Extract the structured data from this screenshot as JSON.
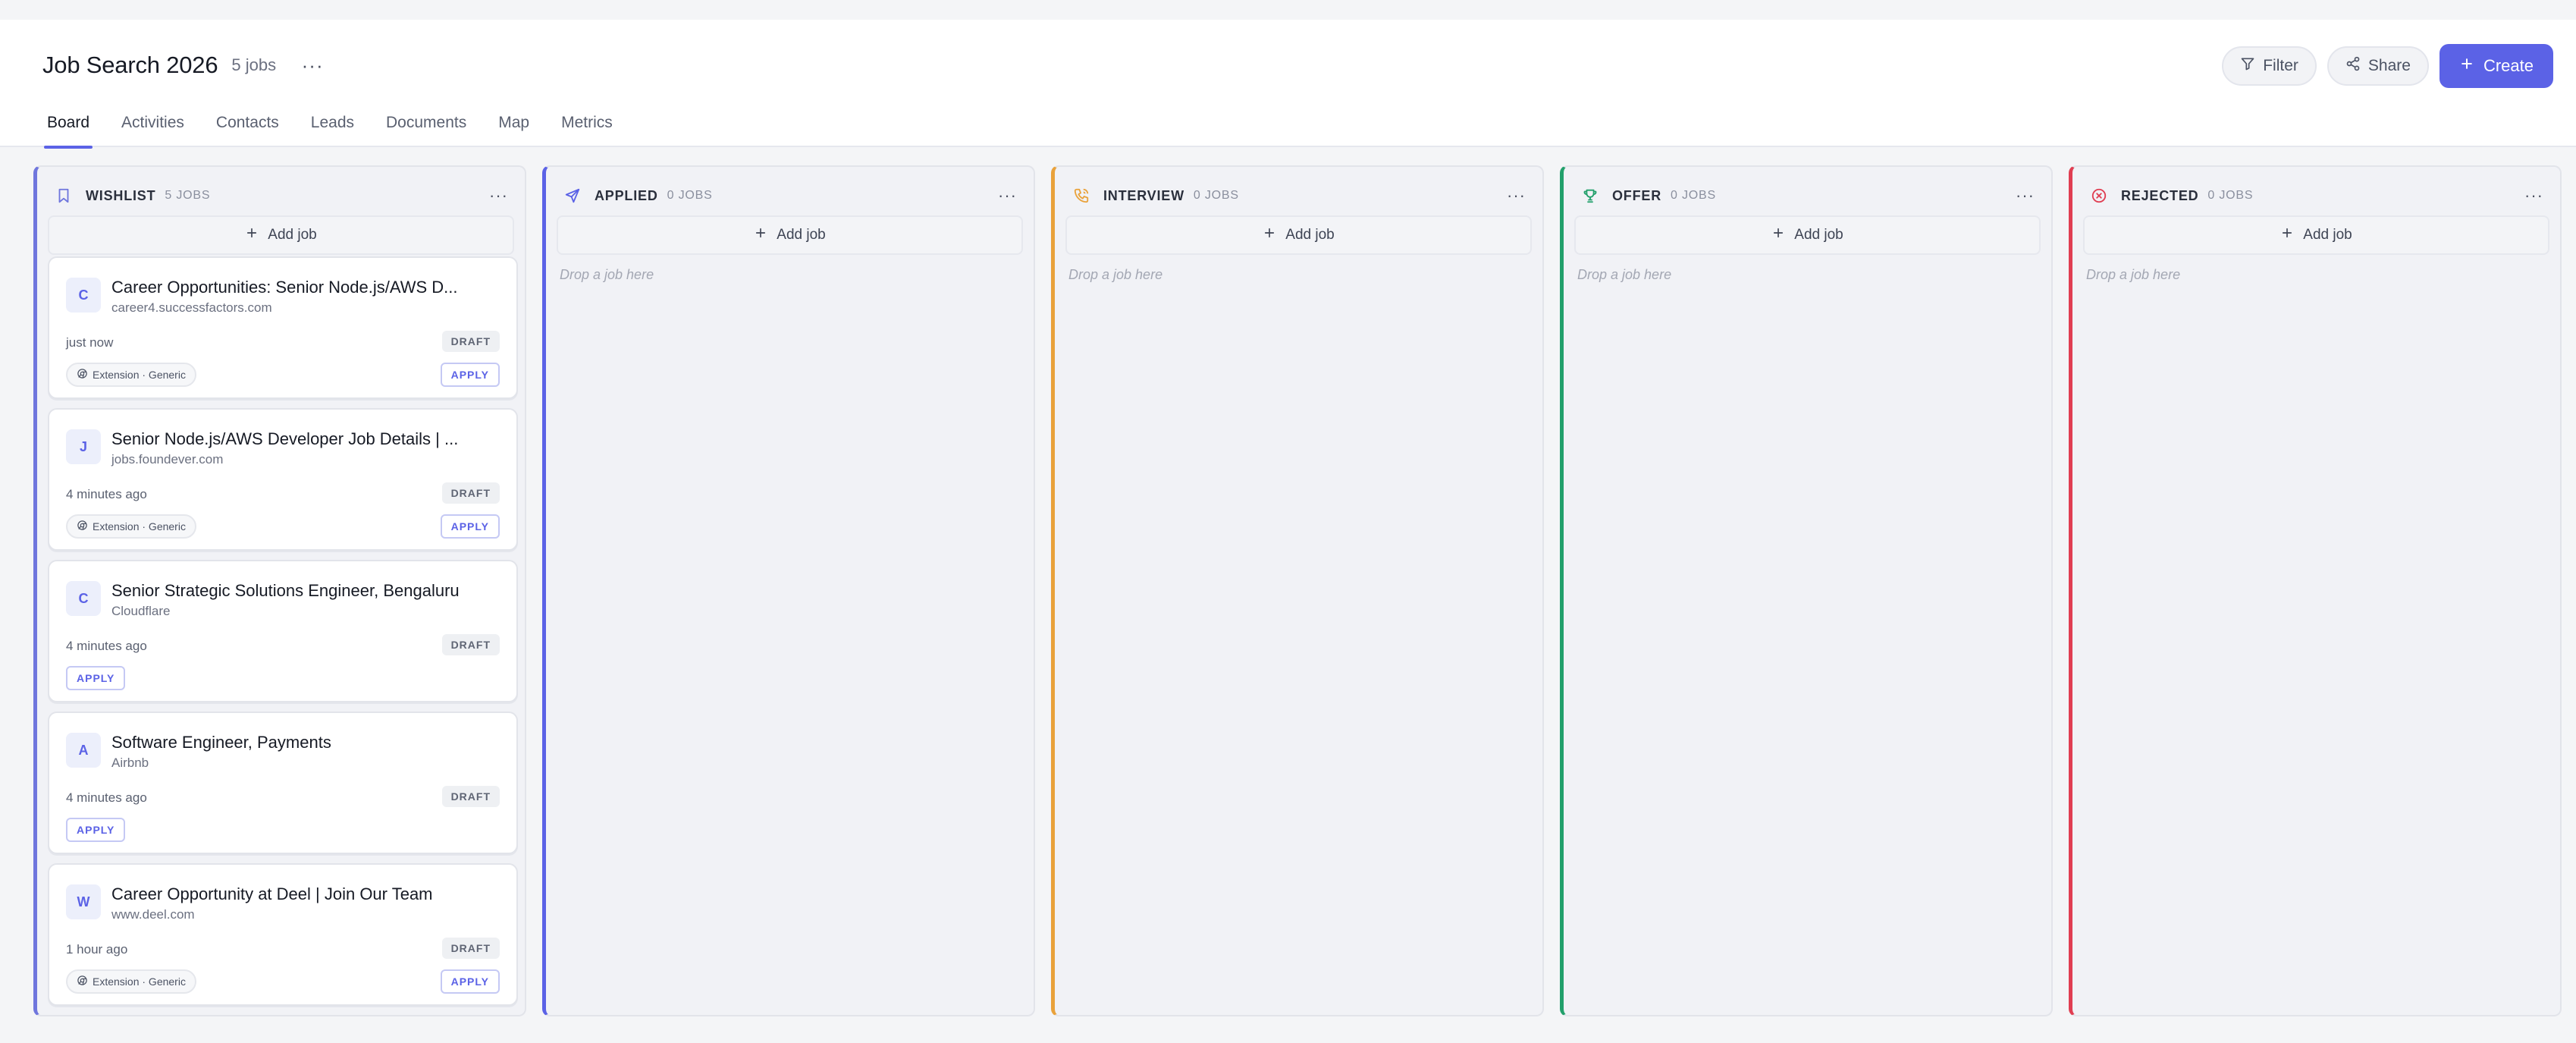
{
  "header": {
    "title": "Job Search 2026",
    "job_count": "5 jobs",
    "more": "···",
    "filter_label": "Filter",
    "share_label": "Share",
    "create_label": "Create"
  },
  "tabs": [
    {
      "label": "Board",
      "active": true
    },
    {
      "label": "Activities"
    },
    {
      "label": "Contacts"
    },
    {
      "label": "Leads"
    },
    {
      "label": "Documents"
    },
    {
      "label": "Map"
    },
    {
      "label": "Metrics"
    }
  ],
  "board": {
    "add_job": "Add job",
    "drop_hint": "Drop a job here",
    "more": "···",
    "columns": [
      {
        "id": "wishlist",
        "title": "WISHLIST",
        "count": "5 JOBS",
        "color": "#6f76dd",
        "icon": "bookmark-icon"
      },
      {
        "id": "applied",
        "title": "APPLIED",
        "count": "0 JOBS",
        "color": "#5b62e6",
        "icon": "send-icon"
      },
      {
        "id": "interview",
        "title": "INTERVIEW",
        "count": "0 JOBS",
        "color": "#e9a23b",
        "icon": "phone-icon"
      },
      {
        "id": "offer",
        "title": "OFFER",
        "count": "0 JOBS",
        "color": "#22a06b",
        "icon": "trophy-icon"
      },
      {
        "id": "rejected",
        "title": "REJECTED",
        "count": "0 JOBS",
        "color": "#e03e52",
        "icon": "x-circle-icon"
      }
    ]
  },
  "cards": [
    {
      "initial": "C",
      "title": "Career Opportunities: Senior Node.js/AWS D...",
      "company": "career4.successfactors.com",
      "time": "just now",
      "status": "DRAFT",
      "tag": "Extension · Generic",
      "apply": "APPLY"
    },
    {
      "initial": "J",
      "title": "Senior Node.js/AWS Developer Job Details | ...",
      "company": "jobs.foundever.com",
      "time": "4 minutes ago",
      "status": "DRAFT",
      "tag": "Extension · Generic",
      "apply": "APPLY"
    },
    {
      "initial": "C",
      "title": "Senior Strategic Solutions Engineer, Bengaluru",
      "company": "Cloudflare",
      "time": "4 minutes ago",
      "status": "DRAFT",
      "apply": "APPLY"
    },
    {
      "initial": "A",
      "title": "Software Engineer, Payments",
      "company": "Airbnb",
      "time": "4 minutes ago",
      "status": "DRAFT",
      "apply": "APPLY"
    },
    {
      "initial": "W",
      "title": "Career Opportunity at Deel | Join Our Team",
      "company": "www.deel.com",
      "time": "1 hour ago",
      "status": "DRAFT",
      "tag": "Extension · Generic",
      "apply": "APPLY"
    }
  ]
}
